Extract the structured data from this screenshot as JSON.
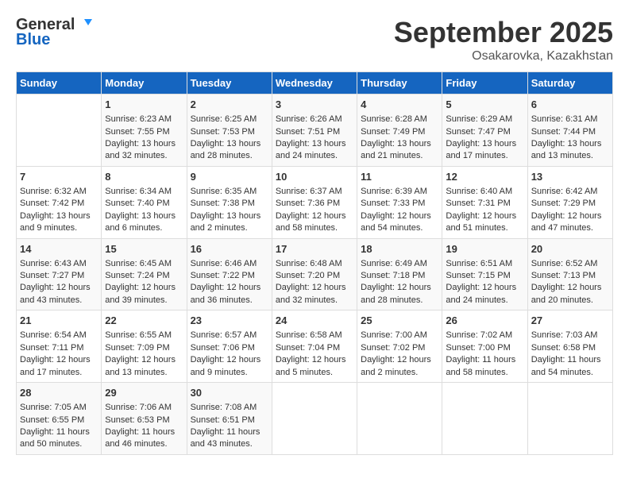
{
  "header": {
    "logo_line1": "General",
    "logo_line2": "Blue",
    "month": "September 2025",
    "location": "Osakarovka, Kazakhstan"
  },
  "weekdays": [
    "Sunday",
    "Monday",
    "Tuesday",
    "Wednesday",
    "Thursday",
    "Friday",
    "Saturday"
  ],
  "weeks": [
    [
      {
        "day": "",
        "info": ""
      },
      {
        "day": "1",
        "info": "Sunrise: 6:23 AM\nSunset: 7:55 PM\nDaylight: 13 hours\nand 32 minutes."
      },
      {
        "day": "2",
        "info": "Sunrise: 6:25 AM\nSunset: 7:53 PM\nDaylight: 13 hours\nand 28 minutes."
      },
      {
        "day": "3",
        "info": "Sunrise: 6:26 AM\nSunset: 7:51 PM\nDaylight: 13 hours\nand 24 minutes."
      },
      {
        "day": "4",
        "info": "Sunrise: 6:28 AM\nSunset: 7:49 PM\nDaylight: 13 hours\nand 21 minutes."
      },
      {
        "day": "5",
        "info": "Sunrise: 6:29 AM\nSunset: 7:47 PM\nDaylight: 13 hours\nand 17 minutes."
      },
      {
        "day": "6",
        "info": "Sunrise: 6:31 AM\nSunset: 7:44 PM\nDaylight: 13 hours\nand 13 minutes."
      }
    ],
    [
      {
        "day": "7",
        "info": "Sunrise: 6:32 AM\nSunset: 7:42 PM\nDaylight: 13 hours\nand 9 minutes."
      },
      {
        "day": "8",
        "info": "Sunrise: 6:34 AM\nSunset: 7:40 PM\nDaylight: 13 hours\nand 6 minutes."
      },
      {
        "day": "9",
        "info": "Sunrise: 6:35 AM\nSunset: 7:38 PM\nDaylight: 13 hours\nand 2 minutes."
      },
      {
        "day": "10",
        "info": "Sunrise: 6:37 AM\nSunset: 7:36 PM\nDaylight: 12 hours\nand 58 minutes."
      },
      {
        "day": "11",
        "info": "Sunrise: 6:39 AM\nSunset: 7:33 PM\nDaylight: 12 hours\nand 54 minutes."
      },
      {
        "day": "12",
        "info": "Sunrise: 6:40 AM\nSunset: 7:31 PM\nDaylight: 12 hours\nand 51 minutes."
      },
      {
        "day": "13",
        "info": "Sunrise: 6:42 AM\nSunset: 7:29 PM\nDaylight: 12 hours\nand 47 minutes."
      }
    ],
    [
      {
        "day": "14",
        "info": "Sunrise: 6:43 AM\nSunset: 7:27 PM\nDaylight: 12 hours\nand 43 minutes."
      },
      {
        "day": "15",
        "info": "Sunrise: 6:45 AM\nSunset: 7:24 PM\nDaylight: 12 hours\nand 39 minutes."
      },
      {
        "day": "16",
        "info": "Sunrise: 6:46 AM\nSunset: 7:22 PM\nDaylight: 12 hours\nand 36 minutes."
      },
      {
        "day": "17",
        "info": "Sunrise: 6:48 AM\nSunset: 7:20 PM\nDaylight: 12 hours\nand 32 minutes."
      },
      {
        "day": "18",
        "info": "Sunrise: 6:49 AM\nSunset: 7:18 PM\nDaylight: 12 hours\nand 28 minutes."
      },
      {
        "day": "19",
        "info": "Sunrise: 6:51 AM\nSunset: 7:15 PM\nDaylight: 12 hours\nand 24 minutes."
      },
      {
        "day": "20",
        "info": "Sunrise: 6:52 AM\nSunset: 7:13 PM\nDaylight: 12 hours\nand 20 minutes."
      }
    ],
    [
      {
        "day": "21",
        "info": "Sunrise: 6:54 AM\nSunset: 7:11 PM\nDaylight: 12 hours\nand 17 minutes."
      },
      {
        "day": "22",
        "info": "Sunrise: 6:55 AM\nSunset: 7:09 PM\nDaylight: 12 hours\nand 13 minutes."
      },
      {
        "day": "23",
        "info": "Sunrise: 6:57 AM\nSunset: 7:06 PM\nDaylight: 12 hours\nand 9 minutes."
      },
      {
        "day": "24",
        "info": "Sunrise: 6:58 AM\nSunset: 7:04 PM\nDaylight: 12 hours\nand 5 minutes."
      },
      {
        "day": "25",
        "info": "Sunrise: 7:00 AM\nSunset: 7:02 PM\nDaylight: 12 hours\nand 2 minutes."
      },
      {
        "day": "26",
        "info": "Sunrise: 7:02 AM\nSunset: 7:00 PM\nDaylight: 11 hours\nand 58 minutes."
      },
      {
        "day": "27",
        "info": "Sunrise: 7:03 AM\nSunset: 6:58 PM\nDaylight: 11 hours\nand 54 minutes."
      }
    ],
    [
      {
        "day": "28",
        "info": "Sunrise: 7:05 AM\nSunset: 6:55 PM\nDaylight: 11 hours\nand 50 minutes."
      },
      {
        "day": "29",
        "info": "Sunrise: 7:06 AM\nSunset: 6:53 PM\nDaylight: 11 hours\nand 46 minutes."
      },
      {
        "day": "30",
        "info": "Sunrise: 7:08 AM\nSunset: 6:51 PM\nDaylight: 11 hours\nand 43 minutes."
      },
      {
        "day": "",
        "info": ""
      },
      {
        "day": "",
        "info": ""
      },
      {
        "day": "",
        "info": ""
      },
      {
        "day": "",
        "info": ""
      }
    ]
  ]
}
